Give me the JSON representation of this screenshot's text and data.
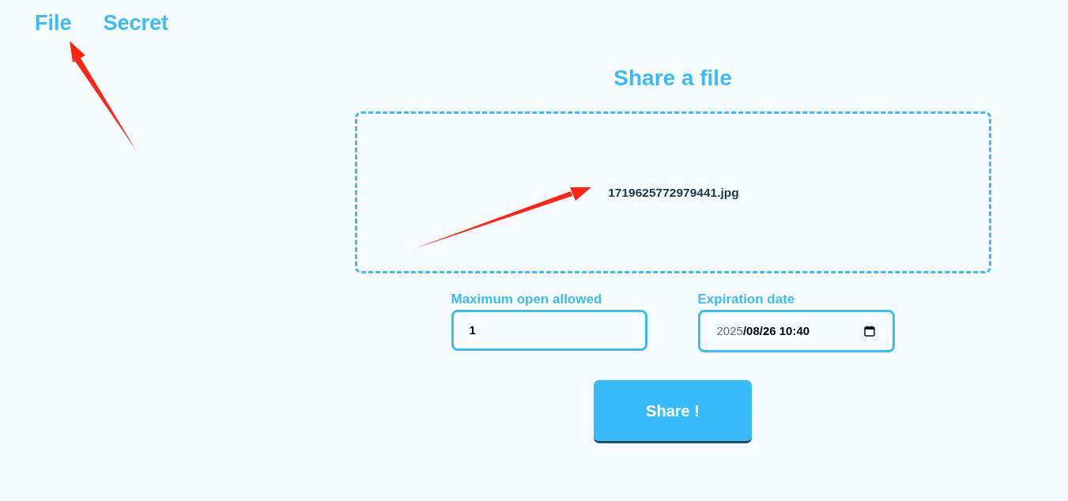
{
  "nav": {
    "items": [
      {
        "label": "File"
      },
      {
        "label": "Secret"
      }
    ]
  },
  "main": {
    "title": "Share a file",
    "dropzone": {
      "file_name": "1719625772979441.jpg"
    },
    "fields": [
      {
        "kind": "number",
        "label": "Maximum open allowed",
        "value": "1"
      },
      {
        "kind": "datetime",
        "label": "Expiration date",
        "value_parts": [
          {
            "text": "2025",
            "dimmed": true
          },
          {
            "text": "/08/26 10:40",
            "dimmed": false
          }
        ]
      }
    ],
    "submit": {
      "label": "Share !"
    }
  }
}
